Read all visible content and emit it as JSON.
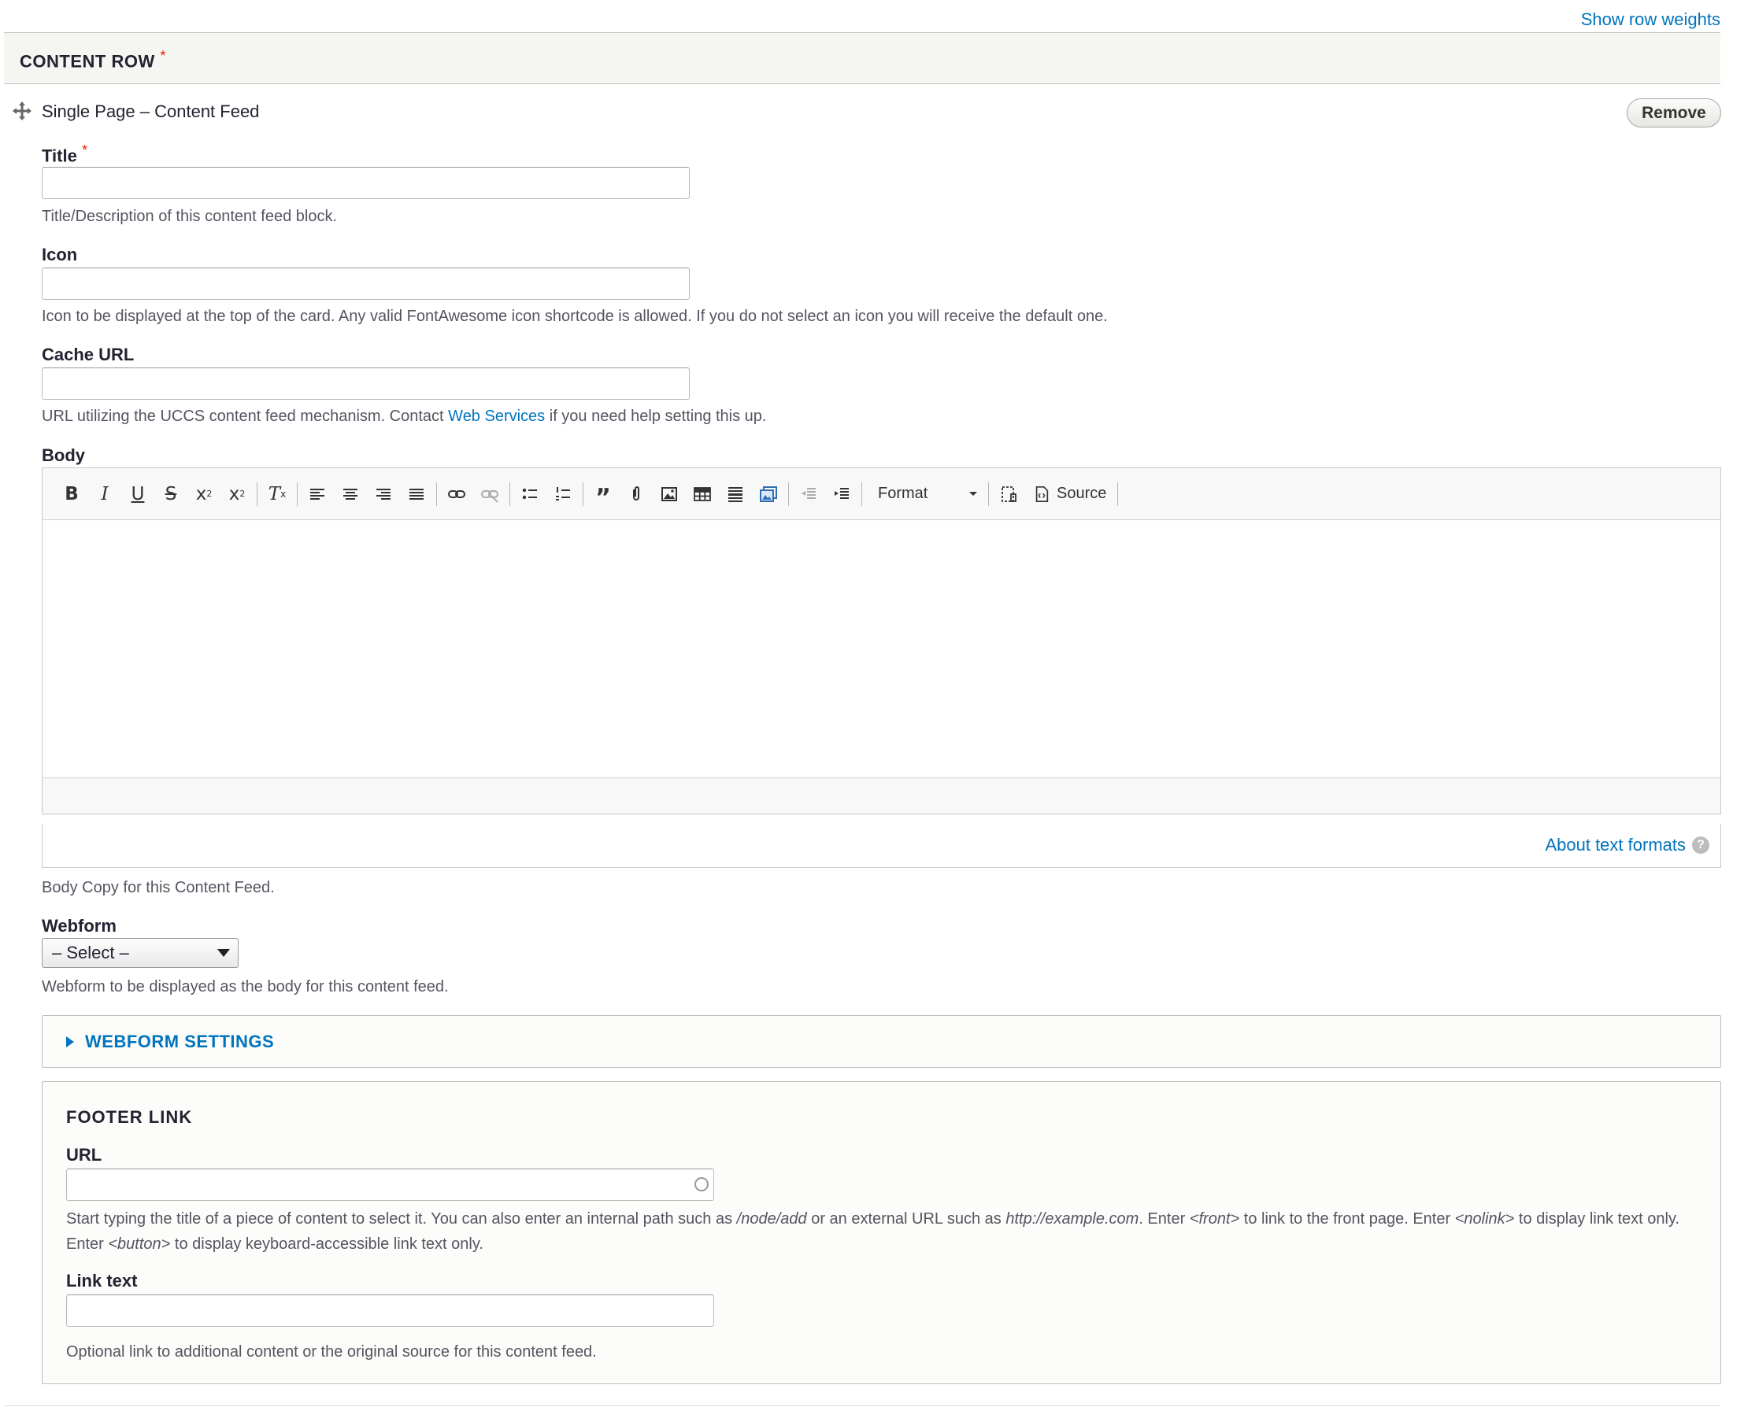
{
  "top_link": "Show row weights",
  "header": {
    "title": "CONTENT ROW",
    "required_mark": "*"
  },
  "item": {
    "title": "Single Page – Content Feed",
    "remove_label": "Remove"
  },
  "fields": {
    "title": {
      "label": "Title",
      "required_mark": "*",
      "value": "",
      "description": "Title/Description of this content feed block."
    },
    "icon": {
      "label": "Icon",
      "value": "",
      "description": "Icon to be displayed at the top of the card. Any valid FontAwesome icon shortcode is allowed. If you do not select an icon you will receive the default one."
    },
    "cache_url": {
      "label": "Cache URL",
      "value": "",
      "description_before": "URL utilizing the UCCS content feed mechanism. Contact ",
      "description_link": "Web Services",
      "description_after": " if you need help setting this up."
    },
    "body": {
      "label": "Body",
      "toolbar": {
        "format_label": "Format",
        "source_label": "Source"
      },
      "about_formats": "About text formats",
      "help_glyph": "?",
      "description": "Body Copy for this Content Feed."
    },
    "webform": {
      "label": "Webform",
      "selected": "– Select –",
      "description": "Webform to be displayed as the body for this content feed."
    }
  },
  "webform_settings": {
    "title": "WEBFORM SETTINGS"
  },
  "footer_link": {
    "legend": "FOOTER LINK",
    "url": {
      "label": "URL",
      "value": "",
      "desc_1": "Start typing the title of a piece of content to select it. You can also enter an internal path such as ",
      "desc_em_1": "/node/add",
      "desc_2": " or an external URL such as ",
      "desc_em_2": "http://example.com",
      "desc_3": ". Enter ",
      "desc_em_3": "<front>",
      "desc_4": " to link to the front page. Enter ",
      "desc_em_4": "<nolink>",
      "desc_5": " to display link text only. Enter ",
      "desc_em_5": "<button>",
      "desc_6": " to display keyboard-accessible link text only."
    },
    "link_text": {
      "label": "Link text",
      "value": "",
      "description": "Optional link to additional content or the original source for this content feed."
    }
  }
}
